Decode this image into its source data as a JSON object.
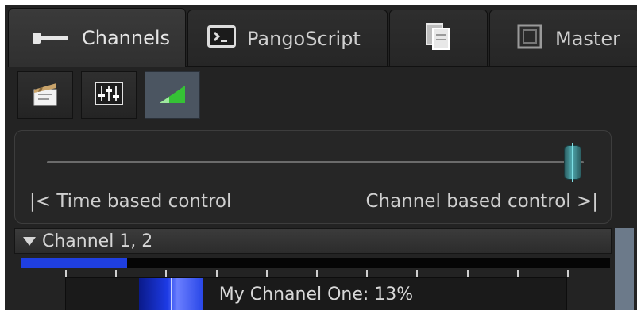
{
  "tabs": [
    {
      "label": "Channels",
      "icon": "channels-icon",
      "active": true
    },
    {
      "label": "PangoScript",
      "icon": "terminal-icon",
      "active": false
    },
    {
      "label": "",
      "icon": "documents-icon",
      "active": false
    },
    {
      "label": "Master",
      "icon": "master-square-icon",
      "active": false
    }
  ],
  "toolbar": [
    {
      "icon": "clapperboard-icon",
      "selected": false
    },
    {
      "icon": "sliders-icon",
      "selected": false
    },
    {
      "icon": "ramp-icon",
      "selected": true
    }
  ],
  "mix_slider": {
    "left_label": "|< Time based control",
    "right_label": "Channel based control >|",
    "position": 0.98
  },
  "channel_group": {
    "title": "Channel 1, 2",
    "progress": 0.18,
    "fader": {
      "label": "My Chnanel One: 13%",
      "position": 0.13
    }
  },
  "colors": {
    "accent_blue": "#1f3fe0",
    "thumb_teal": "#4fa8ae",
    "ramp_green": "#35c235",
    "selected_button": "#4b5561"
  }
}
